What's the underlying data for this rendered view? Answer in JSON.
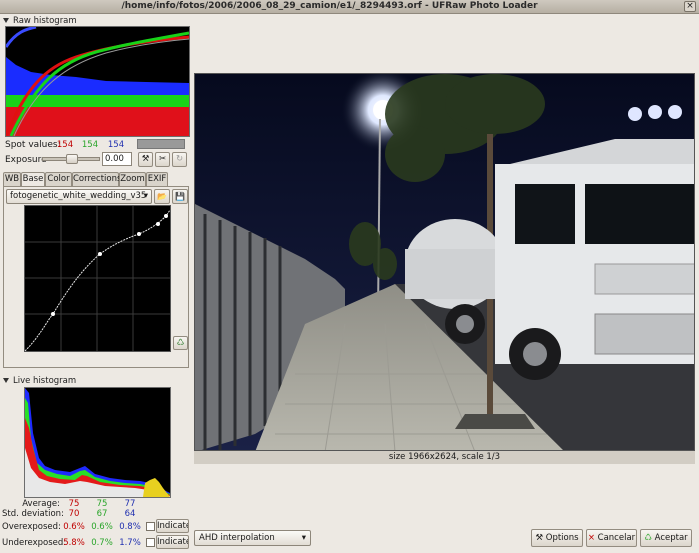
{
  "window": {
    "title": "/home/info/fotos/2006/2006_08_29_camion/e1/_8294493.orf - UFRaw Photo Loader",
    "close_glyph": "×"
  },
  "raw_histogram": {
    "title": "Raw histogram"
  },
  "spot_values": {
    "label": "Spot values:",
    "r": "154",
    "g": "154",
    "b": "154"
  },
  "exposure": {
    "label": "Exposure",
    "value": "0.00",
    "level": 0.5
  },
  "tabs": [
    {
      "label": "WB"
    },
    {
      "label": "Base"
    },
    {
      "label": "Color"
    },
    {
      "label": "Corrections"
    },
    {
      "label": "Zoom"
    },
    {
      "label": "EXIF"
    }
  ],
  "curve_select": {
    "value": "fotogenetic_white_wedding_v35"
  },
  "live_histogram": {
    "title": "Live histogram"
  },
  "stats": {
    "average": {
      "label": "Average:",
      "r": "75",
      "g": "75",
      "b": "77"
    },
    "std": {
      "label": "Std. deviation:",
      "r": "70",
      "g": "67",
      "b": "64"
    },
    "over": {
      "label": "Overexposed:",
      "r": "0.6%",
      "g": "0.6%",
      "b": "0.8%",
      "button": "Indicate"
    },
    "under": {
      "label": "Underexposed:",
      "r": "5.8%",
      "g": "0.7%",
      "b": "1.7%",
      "button": "Indicate"
    }
  },
  "image_caption": "size 1966x2624, scale 1/3",
  "interpolation": {
    "value": "AHD interpolation"
  },
  "buttons": {
    "options": "Options",
    "cancel": "Cancelar",
    "accept": "Aceptar"
  },
  "icons": {
    "close": "×",
    "wand": "⚒",
    "clip": "✂",
    "reset": "↻",
    "open": "📂",
    "save": "💾",
    "dropdown": "▾",
    "apply": "♺"
  }
}
